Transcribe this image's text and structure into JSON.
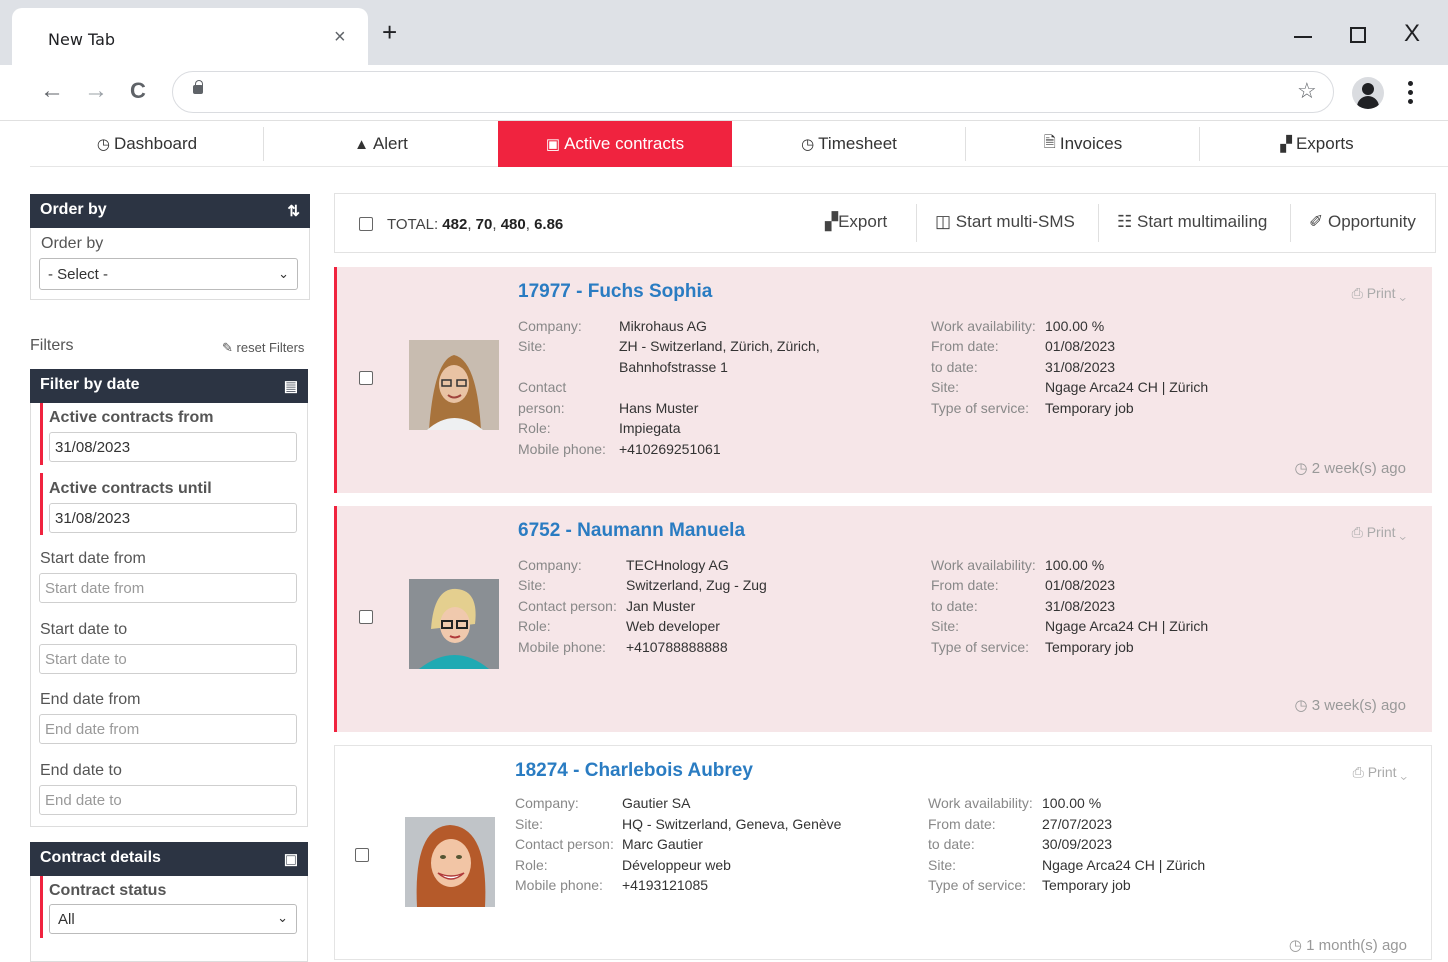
{
  "browser": {
    "tab_title": "New Tab",
    "tab_close": "×",
    "new_tab": "+",
    "back": "←",
    "forward": "→",
    "reload": "C",
    "star": "☆",
    "win_close": "X"
  },
  "nav": {
    "tabs": [
      {
        "label": "Dashboard",
        "icon": "◷"
      },
      {
        "label": "Alert",
        "icon": "🔔"
      },
      {
        "label": "Active contracts",
        "icon": "▣"
      },
      {
        "label": "Timesheet",
        "icon": "◷"
      },
      {
        "label": "Invoices",
        "icon": "🗎"
      },
      {
        "label": "Exports",
        "icon": "▞"
      }
    ],
    "active_color": "#f0233f"
  },
  "sidebar": {
    "order_by_title": "Order by",
    "order_by_label": "Order by",
    "order_by_value": "- Select -",
    "filters_label": "Filters",
    "reset_filters": "reset Filters",
    "filter_by_date_title": "Filter by date",
    "active_from_label": "Active contracts from",
    "active_from_value": "31/08/2023",
    "active_until_label": "Active contracts until",
    "active_until_value": "31/08/2023",
    "start_from_label": "Start date from",
    "start_from_placeholder": "Start date from",
    "start_to_label": "Start date to",
    "start_to_placeholder": "Start date to",
    "end_from_label": "End date from",
    "end_from_placeholder": "End date from",
    "end_to_label": "End date to",
    "end_to_placeholder": "End date to",
    "contract_details_title": "Contract details",
    "contract_status_label": "Contract status",
    "contract_status_value": "All"
  },
  "topbar": {
    "total_label": "TOTAL:",
    "total_values": [
      "482",
      "70",
      "480",
      "6.86"
    ],
    "export": "Export",
    "multi_sms": "Start multi-SMS",
    "multimailing": "Start multimailing",
    "opportunity": "Opportunity"
  },
  "labels": {
    "company": "Company:",
    "site": "Site:",
    "contact": "Contact",
    "person": "person:",
    "contact_person": "Contact person:",
    "role": "Role:",
    "mobile": "Mobile phone:",
    "work_availability": "Work availability:",
    "from_date": "From date:",
    "to_date": "to date:",
    "site2": "Site:",
    "type_of_service": "Type of service:",
    "print": "Print"
  },
  "contracts": [
    {
      "title": "17977 - Fuchs Sophia",
      "company": "Mikrohaus AG",
      "site_line1": "ZH - Switzerland, Zürich, Zürich,",
      "site_line2": "Bahnhofstrasse 1",
      "contact_person": "Hans Muster",
      "role": "Impiegata",
      "mobile": "+410269251061",
      "work_availability": "100.00 %",
      "from_date": "01/08/2023",
      "to_date": "31/08/2023",
      "site": "Ngage Arca24 CH | Zürich",
      "type_of_service": "Temporary job",
      "ago": "2 week(s) ago"
    },
    {
      "title": "6752 - Naumann Manuela",
      "company": "TECHnology AG",
      "site_line1": "Switzerland, Zug - Zug",
      "contact_person": "Jan Muster",
      "role": "Web developer",
      "mobile": "+410788888888",
      "work_availability": "100.00 %",
      "from_date": "01/08/2023",
      "to_date": "31/08/2023",
      "site": "Ngage Arca24 CH | Zürich",
      "type_of_service": "Temporary job",
      "ago": "3 week(s) ago"
    },
    {
      "title": "18274 - Charlebois Aubrey",
      "company": "Gautier SA",
      "site_line1": "HQ - Switzerland, Geneva, Genève",
      "contact_person": "Marc Gautier",
      "role": "Développeur web",
      "mobile": "+4193121085",
      "work_availability": "100.00 %",
      "from_date": "27/07/2023",
      "to_date": "30/09/2023",
      "site": "Ngage Arca24 CH | Zürich",
      "type_of_service": "Temporary job",
      "ago": "1 month(s) ago"
    }
  ]
}
